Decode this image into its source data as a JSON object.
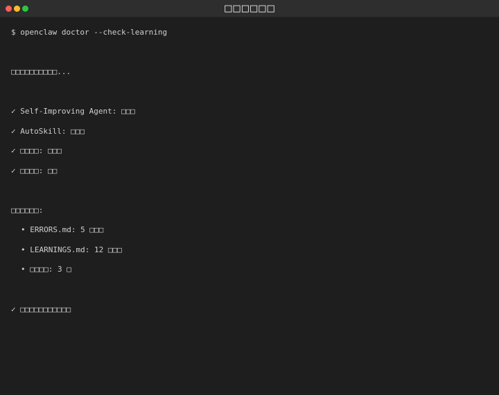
{
  "window": {
    "title": "□□□□□□"
  },
  "terminal": {
    "prompt": "$ openclaw doctor --check-learning",
    "checking": "□□□□□□□□□□...",
    "checks": [
      "✓ Self-Improving Agent: □□□",
      "✓ AutoSkill: □□□",
      "✓ □□□□: □□□",
      "✓ □□□□: □□"
    ],
    "stats_heading": "□□□□□□:",
    "stats": [
      "• ERRORS.md: 5 □□□",
      "• LEARNINGS.md: 12 □□□",
      "• □□□□: 3 □"
    ],
    "final": "✓ □□□□□□□□□□□"
  }
}
